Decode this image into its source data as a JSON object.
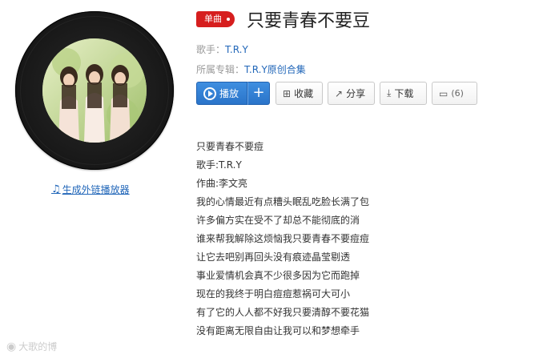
{
  "song": {
    "badge": "单曲",
    "title": "只要青春不要豆",
    "singer_label": "歌手：",
    "singer": "T.R.Y",
    "album_label": "所属专辑：",
    "album": "T.R.Y原创合集"
  },
  "actions": {
    "play": "播放",
    "add": "+",
    "collect": "收藏",
    "share": "分享",
    "download": "下载",
    "comment_count": "(6)"
  },
  "external_player_link": "生成外链播放器",
  "lyrics": [
    "只要青春不要痘",
    "歌手:T.R.Y",
    "作曲:李文亮",
    "我的心情最近有点糟头眠乱吃脸长满了包",
    "许多偏方实在受不了却总不能彻底的消",
    "谁来帮我解除这烦恼我只要青春不要痘痘",
    "让它去吧别再回头没有痕迹晶莹剔透",
    "事业爱情机会真不少很多因为它而跑掉",
    "现在的我终于明白痘痘惹祸可大可小",
    "有了它的人人都不好我只要清醇不要花猫",
    "没有距离无限自由让我可以和梦想牵手"
  ],
  "watermark": "大歌的博",
  "colors": {
    "accent_blue": "#2a74c9",
    "badge_red": "#d61e1e",
    "link_blue": "#2267b9"
  },
  "icons": {
    "play": "play-circle-icon",
    "collect": "collect-icon",
    "share": "share-icon",
    "download": "download-icon",
    "comment": "comment-icon",
    "music_note": "music-note-icon",
    "weibo": "weibo-icon"
  }
}
